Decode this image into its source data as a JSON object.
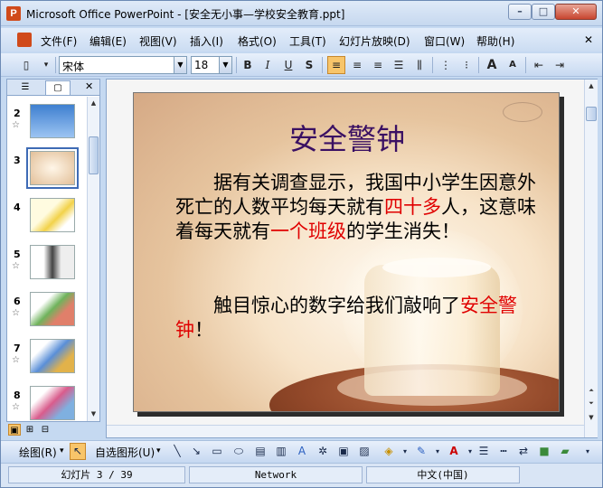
{
  "window": {
    "title": "Microsoft Office PowerPoint - [安全无小事—学校安全教育.ppt]",
    "app_icon_letter": "P",
    "minimize": "–",
    "maximize": "□",
    "close": "✕"
  },
  "menu": {
    "items": [
      "文件(F)",
      "编辑(E)",
      "视图(V)",
      "插入(I)",
      "格式(O)",
      "工具(T)",
      "幻灯片放映(D)",
      "窗口(W)",
      "帮助(H)"
    ],
    "close": "✕"
  },
  "toolbar": {
    "font_name": "宋体",
    "font_size": "18",
    "bold": "B",
    "italic": "I",
    "underline": "U",
    "shadow": "S",
    "grow_font": "A",
    "shrink_font": "A"
  },
  "left_pane": {
    "tab_outline_icon": "outline-icon",
    "tab_slides_icon": "slides-icon",
    "close": "✕",
    "thumbnails": [
      {
        "number": "2",
        "star": "☆"
      },
      {
        "number": "3",
        "star": ""
      },
      {
        "number": "4",
        "star": ""
      },
      {
        "number": "5",
        "star": "☆"
      },
      {
        "number": "6",
        "star": "☆"
      },
      {
        "number": "7",
        "star": "☆"
      },
      {
        "number": "8",
        "star": "☆"
      }
    ],
    "selected_slide": "3"
  },
  "slide": {
    "title": "安全警钟",
    "para1_a": "据有关调查显示，我国中小学生因意外死亡的人数平均每天就有",
    "para1_red1": "四十多",
    "para1_b": "人，这意味着每天就有",
    "para1_red2": "一个班级",
    "para1_c": "的学生消失！",
    "para2_a": "触目惊心的数字给我们敲响了",
    "para2_red": "安全警钟",
    "para2_b": "！"
  },
  "drawbar": {
    "draw_label": "绘图(R)",
    "autoshapes_label": "自选图形(U)"
  },
  "status": {
    "slide_info": "幻灯片 3 / 39",
    "design": "Network",
    "language": "中文(中国)"
  },
  "colors": {
    "title_color": "#3a1063",
    "highlight_red": "#e00000",
    "accent_active": "#f8c56a"
  }
}
